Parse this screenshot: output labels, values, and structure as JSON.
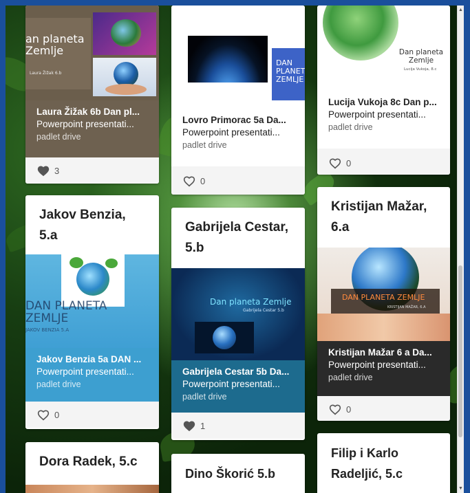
{
  "cards": [
    {
      "id": "laura",
      "title": "",
      "slide": {
        "heading": "an planeta Zemlje",
        "author": "Laura Žižak 6.b"
      },
      "attachment": {
        "title": "Laura Žižak 6b Dan pl...",
        "type": "Powerpoint presentati...",
        "source": "padlet drive"
      },
      "likes": "3"
    },
    {
      "id": "lovro",
      "title": "",
      "slide": {
        "heading": "DAN PLANETA ZEMLJE"
      },
      "attachment": {
        "title": "Lovro Primorac 5a Da...",
        "type": "Powerpoint presentati...",
        "source": "padlet drive"
      },
      "likes": "0"
    },
    {
      "id": "lucija",
      "title": "",
      "slide": {
        "heading": "Dan planeta Zemlje",
        "author": "Lucija Vukoja, 8.c"
      },
      "attachment": {
        "title": "Lucija Vukoja 8c Dan p...",
        "type": "Powerpoint presentati...",
        "source": "padlet drive"
      },
      "likes": "0"
    },
    {
      "id": "jakov",
      "title": "Jakov Benzia, 5.a",
      "slide": {
        "heading": "DAN PLANETA ZEMLJE",
        "author": "JAKOV BENZIA 5.A"
      },
      "attachment": {
        "title": "Jakov Benzia 5a DAN ...",
        "type": "Powerpoint presentati...",
        "source": "padlet drive"
      },
      "likes": "0"
    },
    {
      "id": "gabrijela",
      "title": "Gabrijela Cestar, 5.b",
      "slide": {
        "heading": "Dan planeta Zemlje",
        "author": "Gabrijela Cestar 5.b"
      },
      "attachment": {
        "title": "Gabrijela Cestar 5b Da...",
        "type": "Powerpoint presentati...",
        "source": "padlet drive"
      },
      "likes": "1"
    },
    {
      "id": "kristijan",
      "title": "Kristijan Mažar, 6.a",
      "slide": {
        "heading": "DAN PLANETA ZEMLJE",
        "author": "KRISTIJAN MAŽAR, 6.A"
      },
      "attachment": {
        "title": "Kristijan Mažar 6 a Da...",
        "type": "Powerpoint presentati...",
        "source": "padlet drive"
      },
      "likes": "0"
    },
    {
      "id": "dora",
      "title": "Dora Radek, 5.c"
    },
    {
      "id": "dino",
      "title": "Dino Škorić 5.b"
    },
    {
      "id": "filip",
      "title": "Filip i Karlo Radeljić, 5.c"
    }
  ],
  "colors": {
    "frame": "#1a4f9c",
    "laura_attach": "#6e6150",
    "lucija_attach": "#ffffff",
    "jakov_attach": "#3d9fd0",
    "gabrijela_attach": "#1d6b8e",
    "kristijan_attach": "#2a2a2a",
    "liked_heart": "#555555"
  }
}
